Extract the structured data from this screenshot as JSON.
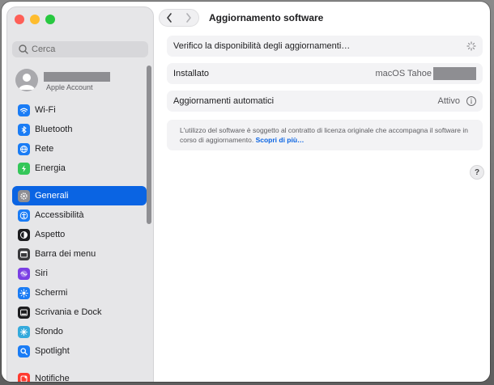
{
  "window": {
    "title": "Aggiornamento software"
  },
  "colors": {
    "accent": "#0a64e3",
    "close": "#fe5f57",
    "minimize": "#febc2e",
    "zoom": "#28c840"
  },
  "sidebar": {
    "search_placeholder": "Cerca",
    "account": {
      "name": "",
      "subtitle": "Apple Account"
    },
    "items": [
      {
        "label": "Wi-Fi",
        "icon": "wifi-icon",
        "color": "#1a7cf5"
      },
      {
        "label": "Bluetooth",
        "icon": "bluetooth-icon",
        "color": "#1a7cf5"
      },
      {
        "label": "Rete",
        "icon": "globe-icon",
        "color": "#1a7cf5"
      },
      {
        "label": "Energia",
        "icon": "battery-icon",
        "color": "#34c759"
      },
      {
        "label": "Generali",
        "icon": "gear-icon",
        "color": "#8e8e93",
        "selected": true
      },
      {
        "label": "Accessibilità",
        "icon": "accessibility-icon",
        "color": "#1a7cf5"
      },
      {
        "label": "Aspetto",
        "icon": "appearance-icon",
        "color": "#1d1d1f"
      },
      {
        "label": "Barra dei menu",
        "icon": "menubar-icon",
        "color": "#3a3a3c"
      },
      {
        "label": "Siri",
        "icon": "siri-icon",
        "color": "#7b3fe4"
      },
      {
        "label": "Schermi",
        "icon": "sun-icon",
        "color": "#1a7cf5"
      },
      {
        "label": "Scrivania e Dock",
        "icon": "dock-icon",
        "color": "#1d1d1f"
      },
      {
        "label": "Sfondo",
        "icon": "wallpaper-icon",
        "color": "#34aadc"
      },
      {
        "label": "Spotlight",
        "icon": "spotlight-icon",
        "color": "#1a7cf5"
      },
      {
        "label": "Notifiche",
        "icon": "notifications-icon",
        "color": "#ff3b30"
      }
    ]
  },
  "main": {
    "check_label": "Verifico la disponibilità degli aggiornamenti…",
    "installed_label": "Installato",
    "installed_value": "macOS Tahoe",
    "auto_label": "Aggiornamenti automatici",
    "auto_value": "Attivo",
    "license_text": "L'utilizzo del software è soggetto al contratto di licenza originale che accompagna il software in corso di aggiornamento.",
    "learn_more": "Scopri di più…",
    "help_label": "?"
  }
}
